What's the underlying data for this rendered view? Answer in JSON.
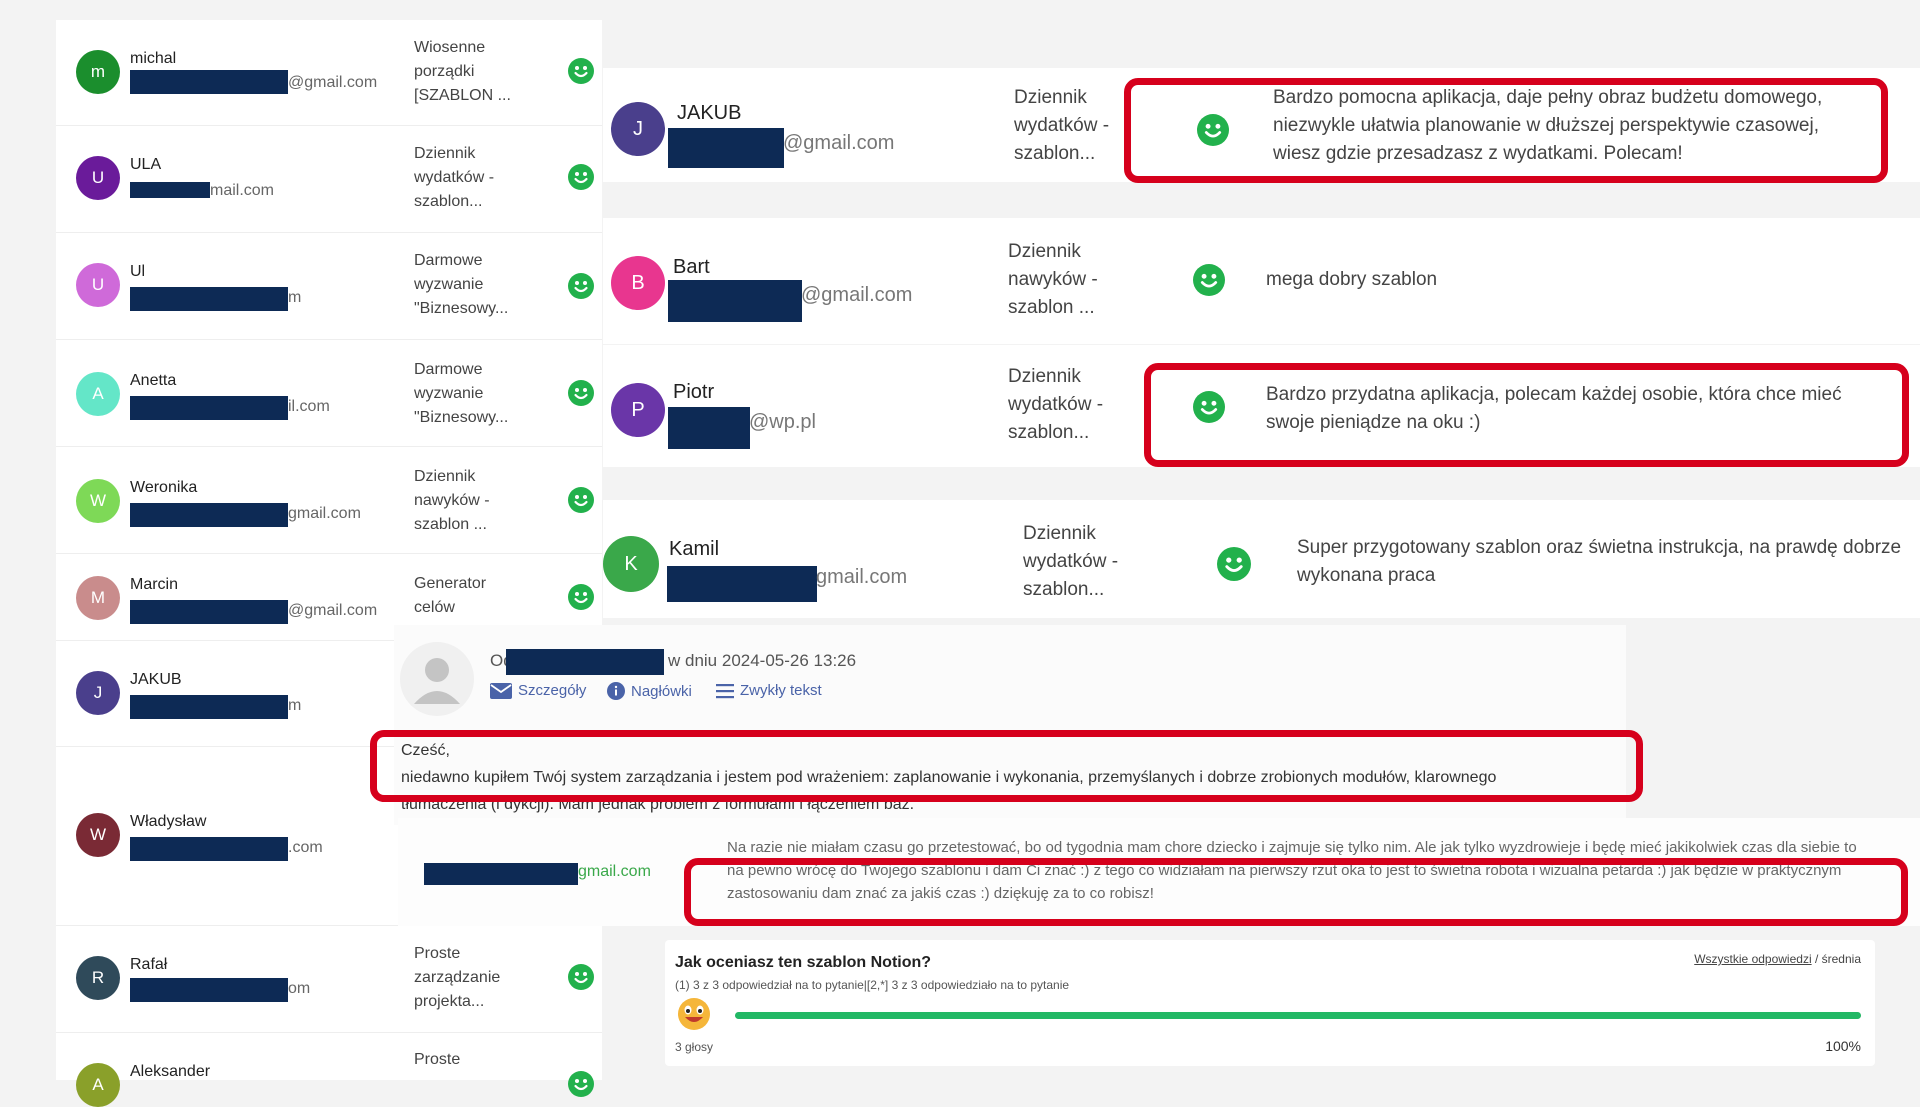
{
  "left_list": [
    {
      "name": "michal",
      "initial": "m",
      "color": "#1b8e2d",
      "email": "@gmail.com",
      "template": "Wiosenne\nporządki\n[SZABLON ..."
    },
    {
      "name": "ULA",
      "initial": "U",
      "color": "#6a1b9a",
      "email": "mail.com",
      "template": "Dziennik\nwydatków -\nszablon..."
    },
    {
      "name": "Ul",
      "initial": "U",
      "color": "#cf6ad9",
      "email": "m",
      "template": "Darmowe\nwyzwanie\n\"Biznesowy..."
    },
    {
      "name": "Anetta",
      "initial": "A",
      "color": "#64e6c8",
      "email": "il.com",
      "template": "Darmowe\nwyzwanie\n\"Biznesowy..."
    },
    {
      "name": "Weronika",
      "initial": "W",
      "color": "#7ed957",
      "email": "gmail.com",
      "template": "Dziennik\nnawyków -\nszablon ..."
    },
    {
      "name": "Marcin",
      "initial": "M",
      "color": "#c98c8c",
      "email": "@gmail.com",
      "template": "Generator\ncelów"
    },
    {
      "name": "JAKUB",
      "initial": "J",
      "color": "#4a3f8c",
      "email": "m",
      "template": ""
    },
    {
      "name": "Władysław",
      "initial": "W",
      "color": "#7a2a35",
      "email": ".com",
      "template": ""
    },
    {
      "name": "Rafał",
      "initial": "R",
      "color": "#2f4a5a",
      "email": "om",
      "template": "Proste\nzarządzanie\nprojekta..."
    },
    {
      "name": "Aleksander",
      "initial": "A",
      "color": "#8aa02a",
      "email": "",
      "template": "Proste"
    }
  ],
  "right_reviews": [
    {
      "name": "JAKUB",
      "initial": "J",
      "color": "#4a3f8c",
      "email": "@gmail.com",
      "template": "Dziennik\nwydatków -\nszablon...",
      "comment": "Bardzo pomocna aplikacja, daje pełny obraz budżetu domowego, niezwykle ułatwia planowanie w dłuższej perspektywie czasowej, wiesz gdzie przesadzasz z wydatkami. Polecam!"
    },
    {
      "name": "Bart",
      "initial": "B",
      "color": "#e8368f",
      "email": "@gmail.com",
      "template": "Dziennik\nnawyków -\nszablon ...",
      "comment": "mega dobry szablon"
    },
    {
      "name": "Piotr",
      "initial": "P",
      "color": "#6a36a8",
      "email": "@wp.pl",
      "template": "Dziennik\nwydatków -\nszablon...",
      "comment": "Bardzo przydatna aplikacja, polecam każdej osobie, która chce mieć swoje pieniądze na oku :)"
    },
    {
      "name": "Kamil",
      "initial": "K",
      "color": "#3aa84a",
      "email": "gmail.com",
      "template": "Dziennik\nwydatków -\nszablon...",
      "comment": "Super przygotowany szablon oraz świetna instrukcja, na prawdę dobrze wykonana praca"
    }
  ],
  "email_view": {
    "from_prefix": "Od",
    "date_text": "w dniu 2024-05-26 13:26",
    "actions": [
      "Szczegóły",
      "Nagłówki",
      "Zwykły tekst"
    ],
    "lines": [
      "Cześć,",
      "niedawno kupiłem Twój system zarządzania i jestem pod wrażeniem: zaplanowanie i wykonania, przemyślanych i dobrze zrobionych modułów, klarownego",
      "tłumaczenia (i dykcji). Mam jednak problem z formułami i łączeniem baz."
    ]
  },
  "reply_card": {
    "email": "gmail.com",
    "text": "Na razie nie miałam czasu go przetestować, bo od tygodnia mam chore dziecko i zajmuje się tylko nim. Ale jak tylko wyzdrowieje i będę mieć jakikolwiek czas dla siebie to na pewno wrócę do Twojego szablonu i dam Ci znać :) z tego co widziałam na pierwszy rzut oka to jest to świetna robota i wizualna petarda :) jak będzie w praktycznym zastosowaniu dam znać za jakiś czas :) dziękuję za to co robisz!"
  },
  "rating": {
    "question": "Jak oceniasz ten szablon Notion?",
    "subtext": "(1) 3 z 3 odpowiedział na to pytanie|[2,*] 3 z 3 odpowiedziało na to pytanie",
    "all_answers": "Wszystkie odpowiedzi",
    "separator": "/",
    "average": "średnia",
    "votes": "3 głosy",
    "percent_label": "100%",
    "percent": 100
  },
  "colors": {
    "smile": "#22b14c",
    "redbox": "#d6001c",
    "redact": "#0d2a55",
    "link": "#4a63a8",
    "progress": "#22b865"
  },
  "icons": {
    "row_status": "smiley-icon",
    "mail": "envelope-icon",
    "info": "info-icon",
    "plaintext": "lines-icon",
    "rating": "emoji-face-icon"
  }
}
